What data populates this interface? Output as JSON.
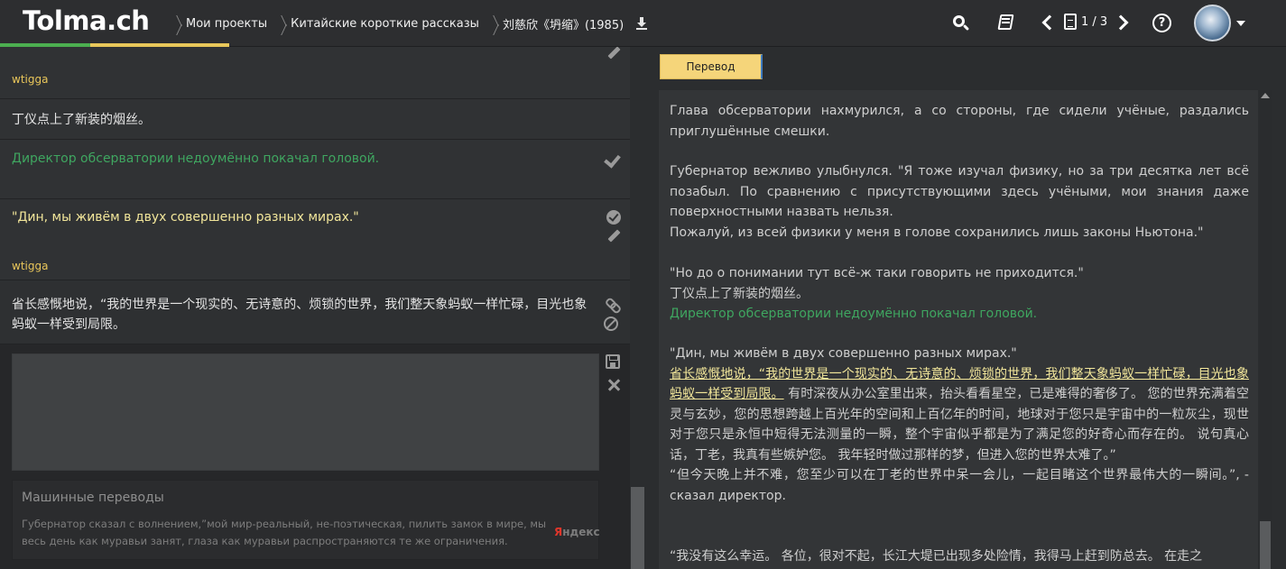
{
  "header": {
    "logo": "Tolma.ch",
    "breadcrumbs": [
      "Мои проекты",
      "Китайские короткие рассказы",
      "刘慈欣《坍缩》(1985)"
    ],
    "pagination": "1 / 3",
    "icons": [
      "search-icon",
      "book-icon",
      "chevron-left-icon",
      "page-icon",
      "chevron-right-icon",
      "help-icon",
      "avatar"
    ]
  },
  "left_panel": {
    "rows": [
      {
        "author": "wtigga"
      },
      {
        "original": "丁仪点上了新装的烟丝。",
        "translation": "Директор обсерватории недоумённо покачал головой."
      },
      {
        "translation": "\"Дин, мы живём в двух совершенно разных мирах.\"",
        "author": "wtigga"
      },
      {
        "original": "省长感慨地说，“我的世界是一个现实的、无诗意的、烦锁的世界，我们整天象蚂蚁一样忙碌，目光也象蚂蚁一样受到局限。"
      }
    ],
    "machine_translation": {
      "title": "Машинные переводы",
      "text": "Губернатор сказал с волнением,”мой мир-реальный, не-поэтическая, пилить замок в мире, мы весь день как муравьи занят, глаза как муравьи распространяются те же ограничения.",
      "provider_prefix": "Я",
      "provider_rest": "ндекс"
    }
  },
  "right_panel": {
    "tab_label": "Перевод",
    "paragraphs": {
      "p1": "Глава обсерватории нахмурился, а со стороны, где сидели учёные, раздались приглушённые смешки.",
      "p2a": "Губернатор вежливо улыбнулся. \"Я тоже изучал физику, но за три десятка лет всё позабыл. По сравнению с присутствующими здесь учёными, мои знания даже поверхностными назвать нельзя.",
      "p2b": "Пожалуй, из всей физики у меня в голове сохранились лишь законы Ньютона.\"",
      "p3a": "\"Но до о понимании тут всё-ж таки говорить не приходится.\"",
      "p3b": "丁仪点上了新装的烟丝。",
      "p3c": "Директор обсерватории недоумённо покачал головой.",
      "p4a": "\"Дин, мы живём в двух совершенно разных мирах.\"",
      "p4b": "省长感慨地说，“我的世界是一个现实的、无诗意的、烦锁的世界，我们整天象蚂蚁一样忙碌，目光也象蚂蚁一样受到局限。",
      "p4c": "有时深夜从办公室里出来，抬头看看星空，已是难得的奢侈了。 您的世界充满着空灵与玄妙，您的思想跨越上百光年的空间和上百亿年的时间，地球对于您只是宇宙中的一粒灰尘，现世对于您只是永恒中短得无法测量的一瞬，整个宇宙似乎都是为了满足您的好奇心而存在的。 说句真心话，丁老，我真有些嫉妒您。 我年轻时做过那样的梦，但进入您的世界太难了。”",
      "p4d": "“但今天晚上并不难，您至少可以在丁老的世界中呆一会儿，一起目睹这个世界最伟大的一瞬间。”, - сказал директор.",
      "p5": "“我没有这么幸运。 各位，很对不起，长江大堤已出现多处险情，我得马上赶到防总去。 在走之"
    }
  },
  "colors": {
    "accent_green": "#3fa660",
    "accent_yellow": "#e8c75a",
    "highlight_yellow": "#f2e69a",
    "tab_bg": "#f5d57a"
  }
}
